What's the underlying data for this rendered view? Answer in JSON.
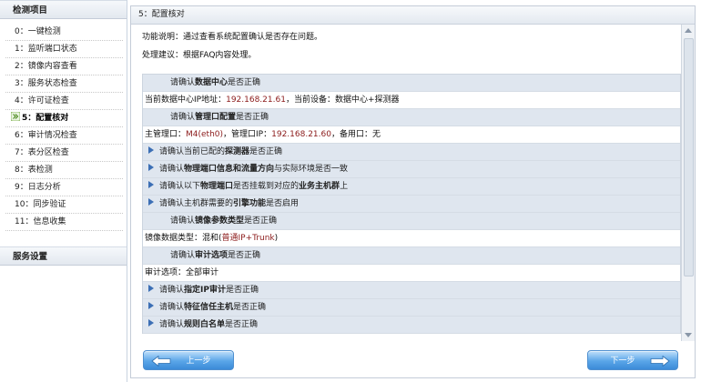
{
  "sidebar": {
    "title": "检测项目",
    "items": [
      {
        "label": "0：一键检测"
      },
      {
        "label": "1：监听端口状态"
      },
      {
        "label": "2：镜像内容查看"
      },
      {
        "label": "3：服务状态检查"
      },
      {
        "label": "4：许可证检查"
      },
      {
        "label": "5：配置核对"
      },
      {
        "label": "6：审计情况检查"
      },
      {
        "label": "7：表分区检查"
      },
      {
        "label": "8：表检测"
      },
      {
        "label": "9：日志分析"
      },
      {
        "label": "10：同步验证"
      },
      {
        "label": "11：信息收集"
      }
    ],
    "active_index": 5,
    "section2_title": "服务设置"
  },
  "main": {
    "title": "5：配置核对",
    "description": "功能说明：通过查看系统配置确认是否存在问题。",
    "suggestion": "处理建议：根据FAQ内容处理。",
    "rows": {
      "q1_pre": "请确认",
      "q1_bold": "数据中心",
      "q1_post": "是否正确",
      "v1_pre": "当前数据中心IP地址：",
      "v1_ip": "192.168.21.61",
      "v1_post": "，当前设备：数据中心+探测器",
      "q2_pre": "请确认",
      "q2_bold": "管理口配置",
      "q2_post": "是否正确",
      "v2_pre": "主管理口：",
      "v2_port": "M4(eth0)",
      "v2_mid": "，管理口IP：",
      "v2_ip": "192.168.21.60",
      "v2_post": "，备用口：无",
      "q3_pre": "请确认当前已配的",
      "q3_bold": "探测器",
      "q3_post": "是否正确",
      "q4_pre": "请确认",
      "q4_bold": "物理端口信息和流量方向",
      "q4_post": "与实际环境是否一致",
      "q5_pre": "请确认以下",
      "q5_bold": "物理端口",
      "q5_mid": "是否挂载到对应的",
      "q5_bold2": "业务主机群",
      "q5_post": "上",
      "q6_pre": "请确认主机群需要的",
      "q6_bold": "引擎功能",
      "q6_post": "是否启用",
      "q7_pre": "请确认",
      "q7_bold": "镜像参数类型",
      "q7_post": "是否正确",
      "v7_pre": "镜像数据类型：混和(",
      "v7_hl": "普通IP+Trunk",
      "v7_post": ")",
      "q8_pre": "请确认",
      "q8_bold": "审计选项",
      "q8_post": "是否正确",
      "v8": "审计选项：全部审计",
      "q9_pre": "请确认",
      "q9_bold": "指定IP审计",
      "q9_post": "是否正确",
      "q10_pre": "请确认",
      "q10_bold": "特征信任主机",
      "q10_post": "是否正确",
      "q11_pre": "请确认",
      "q11_bold": "规则白名单",
      "q11_post": "是否正确"
    }
  },
  "buttons": {
    "prev": "上一步",
    "next": "下一步"
  },
  "colors": {
    "row_header_bg": "#dfe6ef",
    "expand_triangle": "#3c6fb5",
    "button_blue": "#5aa5e8",
    "value_highlight": "#8b1a1a"
  },
  "icons": {
    "active_item": "double-chevron-right-icon",
    "expandable_row": "triangle-right-icon",
    "prev_button": "arrow-left-icon",
    "next_button": "arrow-right-icon"
  }
}
